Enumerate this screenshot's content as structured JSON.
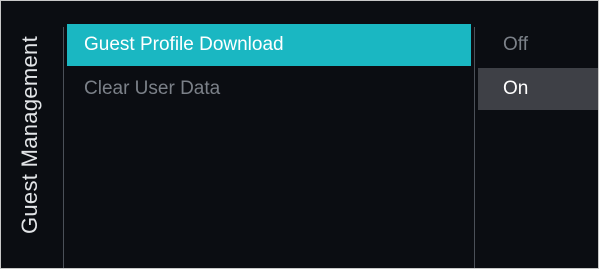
{
  "section": {
    "title": "Guest Management"
  },
  "menu": {
    "items": [
      {
        "label": "Guest Profile Download"
      },
      {
        "label": "Clear User Data"
      }
    ]
  },
  "options": {
    "items": [
      {
        "label": "Off"
      },
      {
        "label": "On"
      }
    ]
  },
  "colors": {
    "background": "#0b0d12",
    "highlight": "#1ab7c2",
    "active_option": "#3e4046",
    "dim_text": "#7b8088"
  }
}
